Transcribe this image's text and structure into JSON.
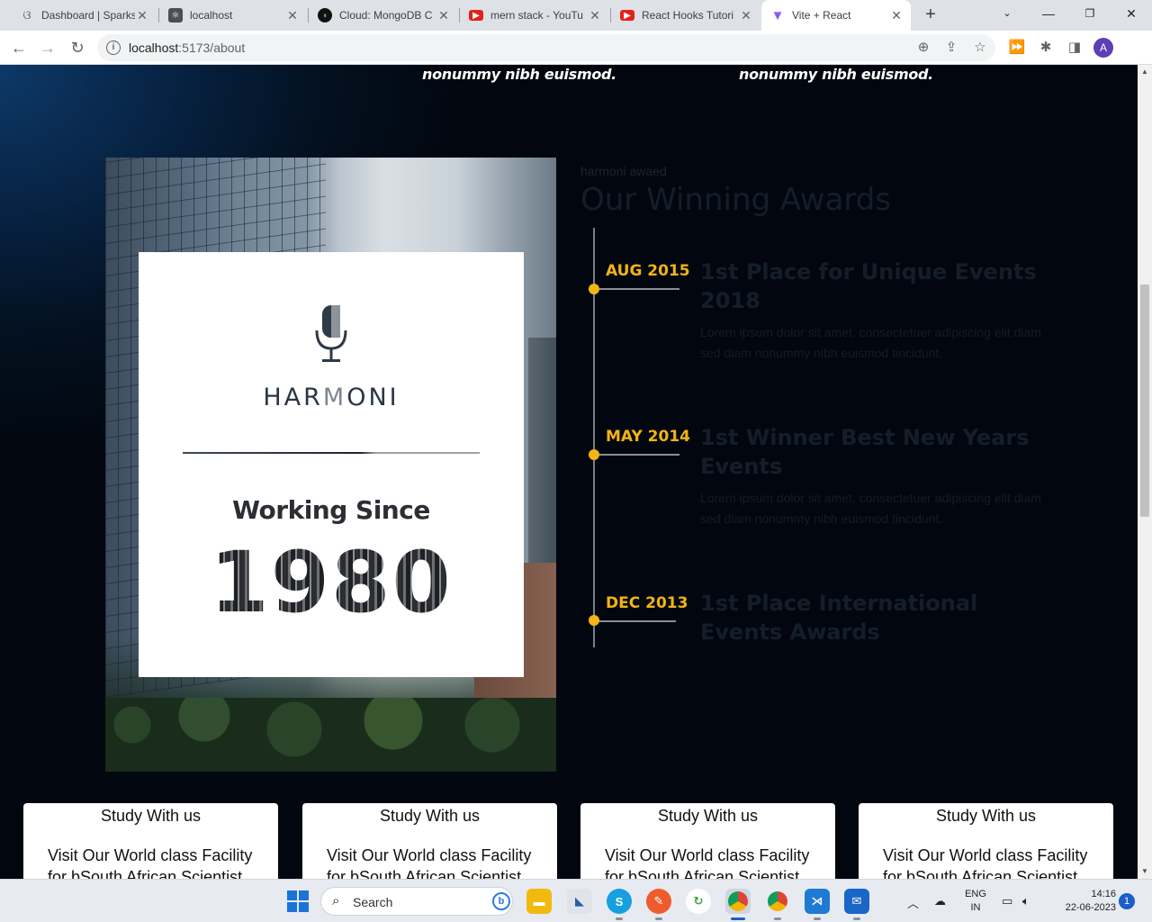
{
  "browser": {
    "tabs": [
      {
        "title": "Dashboard | Sparks",
        "favicon": "sparks-icon"
      },
      {
        "title": "localhost",
        "favicon": "react-icon"
      },
      {
        "title": "Cloud: MongoDB C",
        "favicon": "mongodb-leaf-icon"
      },
      {
        "title": "mern stack - YouTu",
        "favicon": "youtube-icon"
      },
      {
        "title": "React Hooks Tutori",
        "favicon": "youtube-icon"
      },
      {
        "title": "Vite + React",
        "favicon": "vite-icon",
        "active": true
      }
    ],
    "url_host": "localhost",
    "url_rest": ":5173/about",
    "profile_initial": "A"
  },
  "page": {
    "top_quotes": [
      "nonummy nibh euismod.",
      "nonummy nibh euismod."
    ],
    "harmoni": {
      "brand_dark": "HAR",
      "brand_mid": "M",
      "brand_light": "ONI",
      "working_since": "Working Since",
      "year": "1980"
    },
    "awards": {
      "eyebrow": "harmoni awaed",
      "title": "Our Winning Awards",
      "items": [
        {
          "date": "AUG 2015",
          "title": "1st Place for Unique Events 2018",
          "desc": "Lorem ipsum dolor sit amet, consectetuer adipiscing elit diam sed diam nonummy nibh euismod tincidunt."
        },
        {
          "date": "MAY 2014",
          "title": "1st Winner Best New Years Events",
          "desc": "Lorem ipsum dolor sit amet, consectetuer adipiscing elit diam sed diam nonummy nibh euismod tincidunt."
        },
        {
          "date": "DEC 2013",
          "title": "1st Place International Events Awards",
          "desc": ""
        }
      ]
    },
    "study_cards": [
      {
        "title": "Study With us",
        "desc": "Visit Our World class Facility for bSouth African Scientist"
      },
      {
        "title": "Study With us",
        "desc": "Visit Our World class Facility for bSouth African Scientist"
      },
      {
        "title": "Study With us",
        "desc": "Visit Our World class Facility for bSouth African Scientist"
      },
      {
        "title": "Study With us",
        "desc": "Visit Our World class Facility for bSouth African Scientist"
      }
    ]
  },
  "taskbar": {
    "search_label": "Search",
    "lang_top": "ENG",
    "lang_bottom": "IN",
    "time": "14:16",
    "date": "22-06-2023",
    "notification_count": "1"
  },
  "colors": {
    "accent": "#f4b414",
    "page_bg": "#03080f"
  }
}
